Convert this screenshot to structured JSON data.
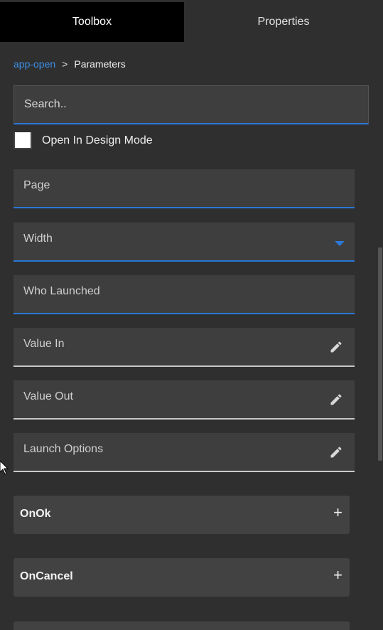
{
  "tabs": {
    "toolbox": "Toolbox",
    "properties": "Properties"
  },
  "breadcrumb": {
    "parent": "app-open",
    "separator": ">",
    "current": "Parameters"
  },
  "search": {
    "placeholder": "Search.."
  },
  "checkbox": {
    "label": "Open In Design Mode",
    "checked": false
  },
  "fields": {
    "page": "Page",
    "width": "Width",
    "who_launched": "Who Launched",
    "value_in": "Value In",
    "value_out": "Value Out",
    "launch_options": "Launch Options"
  },
  "events": {
    "onok": "OnOk",
    "oncancel": "OnCancel",
    "add_symbol": "+"
  },
  "icons": {
    "edit": "pencil-icon",
    "dropdown": "chevron-down-icon",
    "add": "plus-icon"
  },
  "colors": {
    "accent": "#2a78d8",
    "link": "#3d8fe6",
    "active_tab": "#000000",
    "panel": "#2f2f2f",
    "field": "#3e3e3e"
  }
}
